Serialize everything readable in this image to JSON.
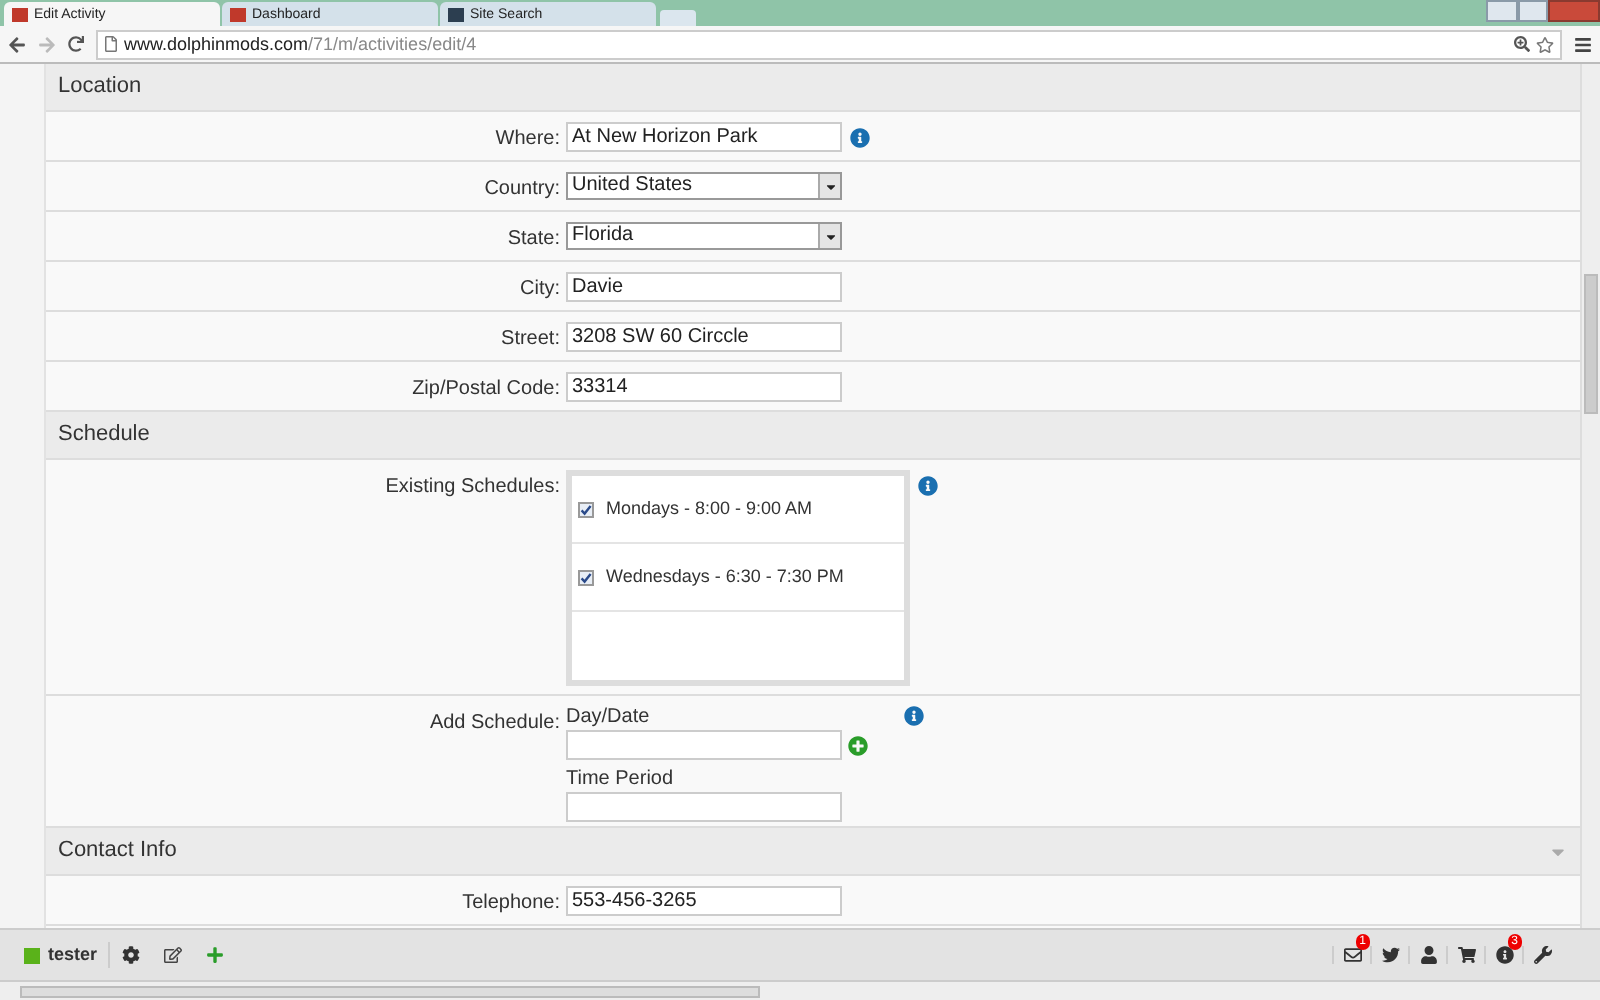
{
  "browser": {
    "tabs": [
      {
        "label": "Edit Activity",
        "selected": true
      },
      {
        "label": "Dashboard",
        "selected": false
      },
      {
        "label": "Site Search",
        "selected": false
      }
    ],
    "url_domain": "www.dolphinmods.com",
    "url_path": "/71/m/activities/edit/4"
  },
  "sections": [
    {
      "title": "Location",
      "collapsible": false,
      "fields": [
        {
          "kind": "text",
          "label": "Where:",
          "value": "At New Horizon Park",
          "info": true
        },
        {
          "kind": "select",
          "label": "Country:",
          "value": "United States",
          "info": false
        },
        {
          "kind": "select",
          "label": "State:",
          "value": "Florida",
          "info": false
        },
        {
          "kind": "text",
          "label": "City:",
          "value": "Davie",
          "info": false
        },
        {
          "kind": "text",
          "label": "Street:",
          "value": "3208 SW 60 Circcle",
          "info": false
        },
        {
          "kind": "text",
          "label": "Zip/Postal Code:",
          "value": "33314",
          "info": false
        }
      ]
    },
    {
      "title": "Schedule",
      "collapsible": false,
      "fields": [
        {
          "kind": "schedules",
          "label": "Existing Schedules:",
          "info": true,
          "items": [
            {
              "label": "Mondays - 8:00 - 9:00 AM",
              "checked": true
            },
            {
              "label": "Wednesdays - 6:30 - 7:30 PM",
              "checked": true
            }
          ]
        },
        {
          "kind": "add_schedule",
          "label": "Add Schedule:",
          "info": true,
          "day_label": "Day/Date",
          "time_label": "Time Period"
        }
      ]
    },
    {
      "title": "Contact Info",
      "collapsible": true,
      "fields": [
        {
          "kind": "text",
          "label": "Telephone:",
          "value": "553-456-3265",
          "info": false
        }
      ]
    }
  ],
  "toolbar": {
    "user": "tester",
    "icons": [
      {
        "kind": "mail",
        "badge": "1"
      },
      {
        "kind": "bird"
      },
      {
        "kind": "user"
      },
      {
        "kind": "cart"
      },
      {
        "kind": "info",
        "badge": "3"
      },
      {
        "kind": "wrench"
      }
    ]
  }
}
